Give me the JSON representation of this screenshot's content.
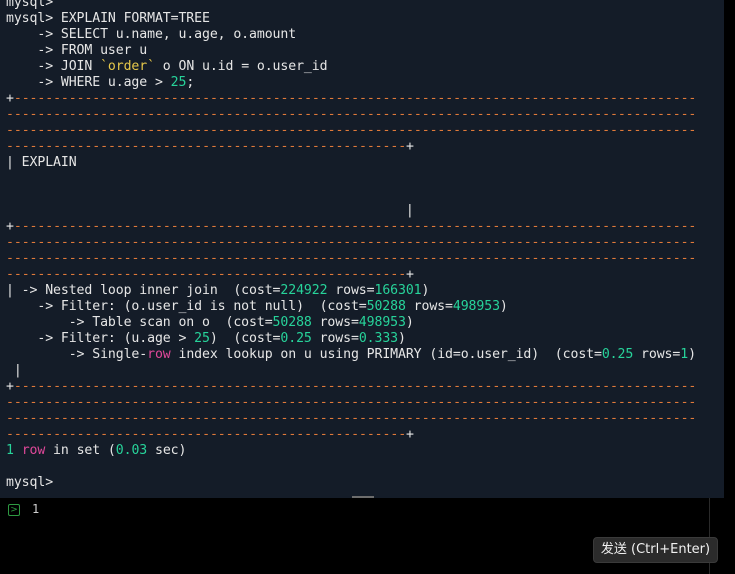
{
  "terminal": {
    "lines": [
      "mysql>",
      "mysql> EXPLAIN FORMAT=TREE",
      "    -> SELECT u.name, u.age, o.amount",
      "    -> FROM user u",
      "    -> JOIN `order` o ON u.id = o.user_id",
      "    -> WHERE u.age > 25;",
      "+---------------------------------------------------------------------------------------",
      "----------------------------------------------------------------------------------------",
      "----------------------------------------------------------------------------------------",
      "---------------------------------------------------+",
      "| EXPLAIN",
      "",
      "",
      "                                                   |",
      "+---------------------------------------------------------------------------------------",
      "----------------------------------------------------------------------------------------",
      "----------------------------------------------------------------------------------------",
      "---------------------------------------------------+",
      "| -> Nested loop inner join  (cost=224922 rows=166301)",
      "    -> Filter: (o.user_id is not null)  (cost=50288 rows=498953)",
      "        -> Table scan on o  (cost=50288 rows=498953)",
      "    -> Filter: (u.age > 25)  (cost=0.25 rows=0.333)",
      "        -> Single-row index lookup on u using PRIMARY (id=o.user_id)  (cost=0.25 rows=1)",
      " |",
      "+---------------------------------------------------------------------------------------",
      "----------------------------------------------------------------------------------------",
      "----------------------------------------------------------------------------------------",
      "---------------------------------------------------+",
      "1 row in set (0.03 sec)",
      "",
      "mysql>"
    ]
  },
  "input": {
    "prompt_icon": "terminal-prompt-icon",
    "text": "1"
  },
  "send_button": {
    "label": "发送 (Ctrl+Enter)"
  },
  "colors": {
    "terminal_bg": "#141c28",
    "dashes": "#e07a3a",
    "numbers": "#27d39a",
    "string": "#e6c84a",
    "keyword": "#e0489a"
  }
}
